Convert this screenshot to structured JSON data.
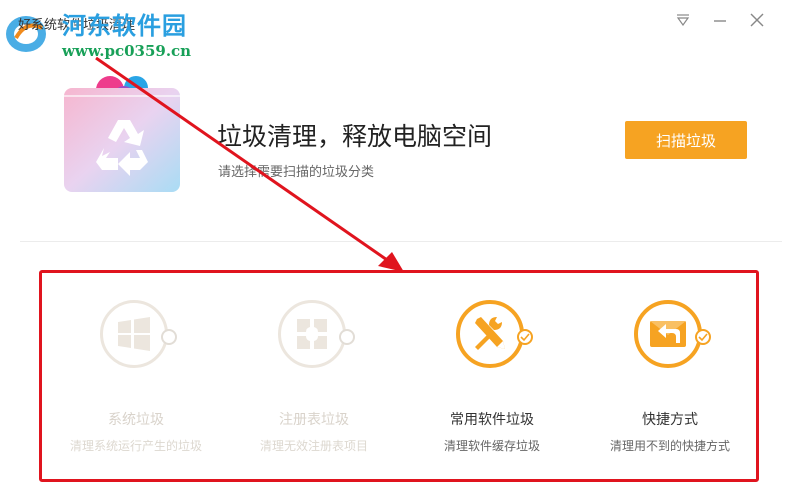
{
  "window": {
    "title": "好系统软件垃圾清理",
    "watermark_name": "河东软件园",
    "watermark_url": "www.pc0359.cn",
    "menu_icon": "triangle-down-icon",
    "minimize_icon": "minimize-icon",
    "close_icon": "close-icon"
  },
  "header": {
    "headline": "垃圾清理，释放电脑空间",
    "subtitle": "请选择需要扫描的垃圾分类",
    "scan_button": "扫描垃圾"
  },
  "colors": {
    "accent": "#f6a322",
    "annotation": "#e0141e",
    "disabled": "#d9d3cb"
  },
  "categories": [
    {
      "title": "系统垃圾",
      "desc": "清理系统运行产生的垃圾",
      "icon": "windows-icon",
      "checked": false
    },
    {
      "title": "注册表垃圾",
      "desc": "清理无效注册表项目",
      "icon": "registry-icon",
      "checked": false
    },
    {
      "title": "常用软件垃圾",
      "desc": "清理软件缓存垃圾",
      "icon": "tools-icon",
      "checked": true
    },
    {
      "title": "快捷方式",
      "desc": "清理用不到的快捷方式",
      "icon": "shortcut-icon",
      "checked": true
    }
  ]
}
